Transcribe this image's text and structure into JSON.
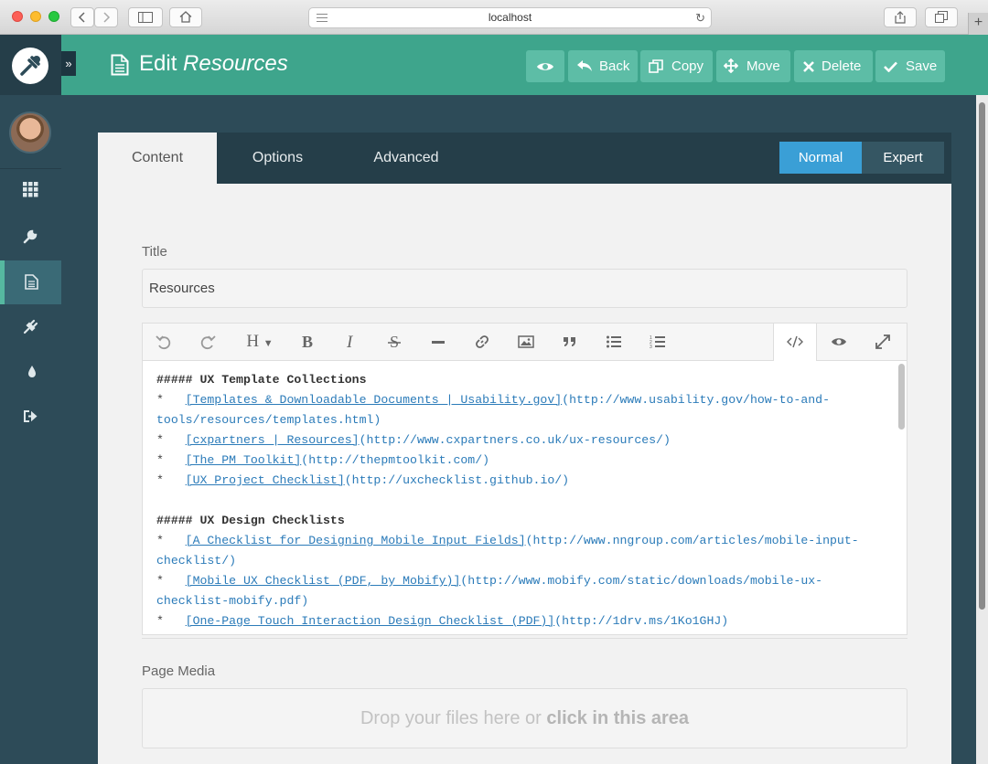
{
  "browser": {
    "url": "localhost",
    "new_tab_glyph": "+"
  },
  "sidebar": {
    "toggle_glyph": "»",
    "items": [
      {
        "icon": "dashboard-grid-icon",
        "active": false
      },
      {
        "icon": "wrench-icon",
        "active": false
      },
      {
        "icon": "page-icon",
        "active": true
      },
      {
        "icon": "plug-icon",
        "active": false
      },
      {
        "icon": "drop-icon",
        "active": false
      },
      {
        "icon": "logout-icon",
        "active": false
      }
    ]
  },
  "header": {
    "title_prefix": "Edit ",
    "title_name": "Resources",
    "buttons": {
      "back": "Back",
      "copy": "Copy",
      "move": "Move",
      "delete": "Delete",
      "save": "Save"
    }
  },
  "tabs": [
    "Content",
    "Options",
    "Advanced"
  ],
  "mode": {
    "normal": "Normal",
    "expert": "Expert"
  },
  "form": {
    "title_label": "Title",
    "title_value": "Resources",
    "page_media_label": "Page Media",
    "dropzone_text": "Drop your files here or ",
    "dropzone_strong": "click in this area"
  },
  "editor": {
    "heading_button": "H",
    "lines": [
      {
        "kind": "heading",
        "text": "##### UX Template Collections"
      },
      {
        "kind": "link",
        "prefix": "*   ",
        "text": "[Templates & Downloadable Documents | Usability.gov]",
        "url": "(http://www.usability.gov/how-to-and-"
      },
      {
        "kind": "plain-url",
        "text": "tools/resources/templates.html)"
      },
      {
        "kind": "link",
        "prefix": "*   ",
        "text": "[cxpartners | Resources]",
        "url": "(http://www.cxpartners.co.uk/ux-resources/)"
      },
      {
        "kind": "link",
        "prefix": "*   ",
        "text": "[The PM Toolkit]",
        "url": "(http://thepmtoolkit.com/)"
      },
      {
        "kind": "link",
        "prefix": "*   ",
        "text": "[UX Project Checklist]",
        "url": "(http://uxchecklist.github.io/)"
      },
      {
        "kind": "blank",
        "text": " "
      },
      {
        "kind": "heading",
        "text": "##### UX Design Checklists"
      },
      {
        "kind": "link",
        "prefix": "*   ",
        "text": "[A Checklist for Designing Mobile Input Fields]",
        "url": "(http://www.nngroup.com/articles/mobile-input-"
      },
      {
        "kind": "plain-url",
        "text": "checklist/)"
      },
      {
        "kind": "link",
        "prefix": "*   ",
        "text": "[Mobile UX Checklist (PDF, by Mobify)]",
        "url": "(http://www.mobify.com/static/downloads/mobile-ux-"
      },
      {
        "kind": "plain-url",
        "text": "checklist-mobify.pdf)"
      },
      {
        "kind": "link",
        "prefix": "*   ",
        "text": "[One-Page Touch Interaction Design Checklist (PDF)]",
        "url": "(http://1drv.ms/1Ko1GHJ)"
      }
    ]
  },
  "colors": {
    "header_bg": "#3ea58c",
    "header_button": "#5dbda6",
    "sidebar_bg": "#2d4b58",
    "tabbar_bg": "#253e49",
    "normal_mode": "#3a9fd6",
    "link": "#2b7bb9"
  }
}
